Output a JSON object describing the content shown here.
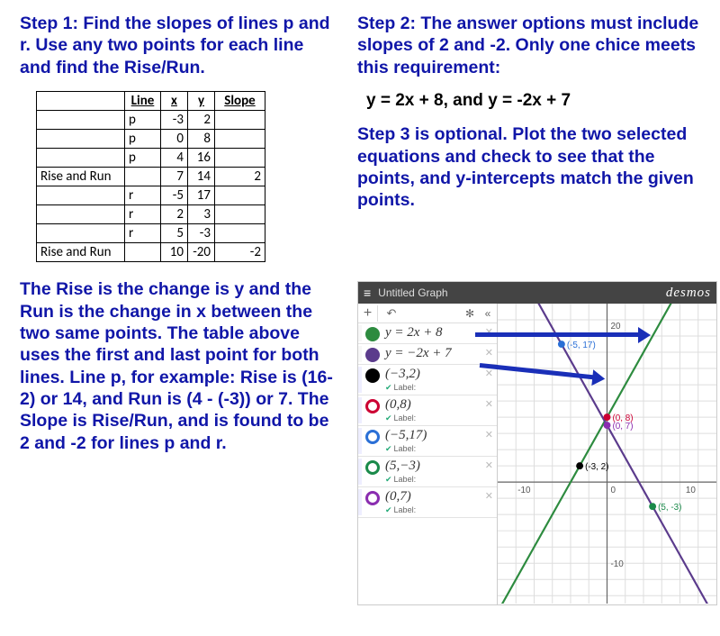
{
  "left": {
    "step1": "Step 1:  Find the slopes of lines p and r.  Use any two points for each line and find the Rise/Run.",
    "table": {
      "headers": [
        "",
        "Line",
        "x",
        "y",
        "Slope"
      ],
      "rows": [
        {
          "label": "",
          "line": "p",
          "x": "-3",
          "y": "2",
          "slope": ""
        },
        {
          "label": "",
          "line": "p",
          "x": "0",
          "y": "8",
          "slope": ""
        },
        {
          "label": "",
          "line": "p",
          "x": "4",
          "y": "16",
          "slope": ""
        },
        {
          "label": "Rise and Run",
          "line": "",
          "x": "7",
          "y": "14",
          "slope": "2"
        },
        {
          "label": "",
          "line": "r",
          "x": "-5",
          "y": "17",
          "slope": ""
        },
        {
          "label": "",
          "line": "r",
          "x": "2",
          "y": "3",
          "slope": ""
        },
        {
          "label": "",
          "line": "r",
          "x": "5",
          "y": "-3",
          "slope": ""
        },
        {
          "label": "Rise and Run",
          "line": "",
          "x": "10",
          "y": "-20",
          "slope": "-2"
        }
      ]
    },
    "explain": "The Rise is the change is y and the Run is the change in x between the two same points.  The table above uses the first and last point for both lines.  Line p, for example:  Rise is (16-2) or 14, and Run is (4 - (-3)) or 7.  The Slope is Rise/Run, and is found to be 2 and -2 for lines p and r."
  },
  "right": {
    "step2": "Step 2:  The answer options must include slopes of 2 and -2.  Only one chice meets this requirement:",
    "answer": "y = 2x + 8, and y = -2x + 7",
    "step3": "Step 3 is optional.  Plot the two selected equations and check to see that the points, and y-intercepts match the given points."
  },
  "desmos": {
    "title": "Untitled Graph",
    "logo": "desmos",
    "entries": [
      {
        "color": "#2d8b3f",
        "fill": "solid",
        "text": "y = 2x + 8"
      },
      {
        "color": "#5b3b8c",
        "fill": "solid",
        "text": "y = −2x + 7"
      },
      {
        "color": "#000",
        "fill": "solid",
        "text": "(−3,2)",
        "label": true
      },
      {
        "color": "#c03",
        "fill": "hollow",
        "text": "(0,8)",
        "label": true
      },
      {
        "color": "#2a6fd6",
        "fill": "hollow",
        "text": "(−5,17)",
        "label": true
      },
      {
        "color": "#1a8a4a",
        "fill": "hollow",
        "text": "(5,−3)",
        "label": true
      },
      {
        "color": "#8a2db0",
        "fill": "hollow",
        "text": "(0,7)",
        "label": true
      }
    ],
    "label_text": "Label:",
    "points": [
      {
        "name": "(-5, 17)",
        "x": -5,
        "y": 17,
        "color": "#2a6fd6"
      },
      {
        "name": "(0, 8)",
        "x": 0,
        "y": 8,
        "color": "#c03"
      },
      {
        "name": "(0, 7)",
        "x": 0,
        "y": 7,
        "color": "#8a2db0"
      },
      {
        "name": "(-3, 2)",
        "x": -3,
        "y": 2,
        "color": "#000"
      },
      {
        "name": "(5, -3)",
        "x": 5,
        "y": -3,
        "color": "#1a8a4a"
      }
    ],
    "axis_labels": {
      "x_neg": "-10",
      "x_pos": "10",
      "y_neg": "-10",
      "zero": "0",
      "y_pos": "20"
    }
  },
  "chart_data": {
    "type": "line",
    "title": "",
    "series": [
      {
        "name": "y = 2x + 8",
        "equation": "y=2x+8",
        "color": "#2d8b3f"
      },
      {
        "name": "y = -2x + 7",
        "equation": "y=-2x+7",
        "color": "#5b3b8c"
      }
    ],
    "points": [
      {
        "label": "(-5, 17)",
        "x": -5,
        "y": 17
      },
      {
        "label": "(0, 8)",
        "x": 0,
        "y": 8
      },
      {
        "label": "(0, 7)",
        "x": 0,
        "y": 7
      },
      {
        "label": "(-3, 2)",
        "x": -3,
        "y": 2
      },
      {
        "label": "(5, -3)",
        "x": 5,
        "y": -3
      }
    ],
    "xlim": [
      -12,
      12
    ],
    "ylim": [
      -15,
      22
    ]
  }
}
